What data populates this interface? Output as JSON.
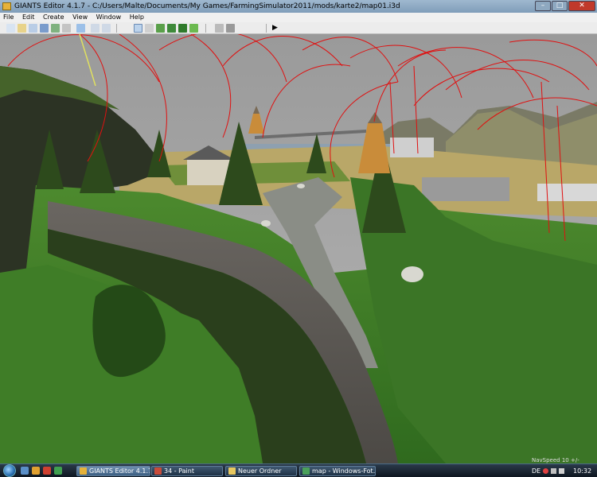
{
  "window": {
    "title": "GIANTS Editor 4.1.7 - C:/Users/Malte/Documents/My Games/FarmingSimulator2011/mods/karte2/map01.i3d",
    "controls": {
      "minimize": "–",
      "maximize": "□",
      "close": "✕"
    }
  },
  "menu": {
    "items": [
      "File",
      "Edit",
      "Create",
      "View",
      "Window",
      "Help"
    ]
  },
  "toolbar": {
    "icons": [
      "new-icon",
      "open-icon",
      "import-icon",
      "save-icon",
      "export-icon",
      "cut-icon",
      "hand-icon",
      "undo-icon",
      "redo-icon",
      "select-icon",
      "move-icon",
      "terrain-icon",
      "paint-icon",
      "foliage-icon",
      "grass-icon",
      "light-icon",
      "camera-icon",
      "play-icon"
    ],
    "play_glyph": "▶"
  },
  "viewport": {
    "status": "NavSpeed 10 +/-"
  },
  "taskbar": {
    "tasks": [
      {
        "label": "GIANTS Editor 4.1.7 ...",
        "color": "#e6b23a"
      },
      {
        "label": "34 - Paint",
        "color": "#c84b3a"
      },
      {
        "label": "Neuer Ordner",
        "color": "#e8c860"
      },
      {
        "label": "map - Windows-Fot...",
        "color": "#4aa05a"
      }
    ],
    "language": "DE",
    "clock": "10:32"
  },
  "colors": {
    "sky": "#a4a4a4",
    "grass": "#3c7a28",
    "road": "#5a5753",
    "rings": "#e01010"
  }
}
